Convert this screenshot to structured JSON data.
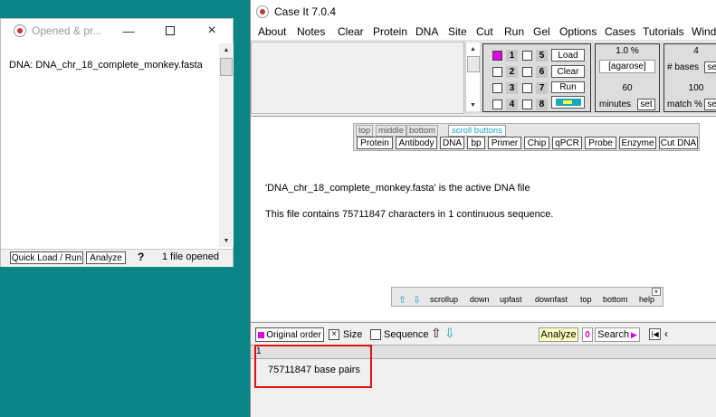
{
  "opened_window": {
    "title": "Opened & pr...",
    "content": "DNA: DNA_chr_18_complete_monkey.fasta",
    "quick_load_label": "Quick Load / Run",
    "analyze_label": "Analyze",
    "help_label": "?",
    "status": "1 file opened"
  },
  "main_window": {
    "title": "Case It 7.0.4",
    "menu": [
      "About",
      "Notes",
      "Clear",
      "Protein",
      "DNA",
      "Site",
      "Cut",
      "Run",
      "Gel",
      "Options",
      "Cases",
      "Tutorials",
      "Windo"
    ]
  },
  "gel_controls": {
    "lanes": [
      "1",
      "2",
      "3",
      "4",
      "5",
      "6",
      "7",
      "8"
    ],
    "load_label": "Load",
    "clear_label": "Clear",
    "run_label": "Run",
    "percent": "1.0 %",
    "agarose": "[agarose]",
    "minutes_value": "60",
    "minutes_label": "minutes",
    "set_label": "set",
    "bases_value": "4",
    "bases_label": "# bases",
    "set2_label": "set",
    "match_value": "100",
    "match_label": "match %",
    "set3_label": "set"
  },
  "toolbar": {
    "tabs": [
      "top",
      "middle",
      "bottom"
    ],
    "scroll_buttons": "scroll buttons",
    "buttons": [
      "Protein",
      "Antibody",
      "DNA",
      "bp",
      "Primer",
      "Chip",
      "qPCR",
      "Probe",
      "Enzyme",
      "Cut DNA"
    ]
  },
  "content": {
    "active_file_msg": "'DNA_chr_18_complete_monkey.fasta' is the active DNA file",
    "char_count_msg": "This file contains 75711847 characters in 1 continuous sequence."
  },
  "nav_panel": {
    "close": "×",
    "links": [
      "scrollup",
      "down",
      "upfast",
      "downfast",
      "top",
      "bottom",
      "help"
    ]
  },
  "bottom_bar": {
    "original_order": "Original order",
    "size_label": "Size",
    "sequence_label": "Sequence",
    "analyze_label": "Analyze",
    "zero_label": "0",
    "search_label": "Search",
    "ruler_mark": "1",
    "base_pairs": "75711847 base pairs"
  },
  "colors": {
    "desktop": "#0a8484",
    "magenta": "#e000e0",
    "cyan": "#1aa7c0",
    "highlight_yellow": "#ffffc0",
    "annotation_red": "#e01010"
  }
}
